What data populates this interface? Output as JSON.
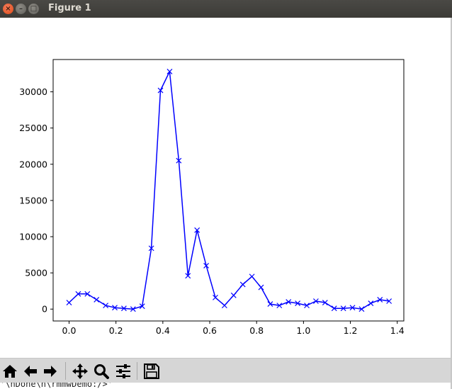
{
  "window": {
    "title": "Figure 1",
    "close_glyph": "×",
    "min_glyph": "–",
    "max_glyph": "□"
  },
  "toolbar": {
    "buttons": [
      {
        "name": "home-button",
        "icon": "home-icon"
      },
      {
        "name": "back-button",
        "icon": "arrow-left-icon"
      },
      {
        "name": "forward-button",
        "icon": "arrow-right-icon"
      },
      {
        "name": "pan-button",
        "icon": "move-icon"
      },
      {
        "name": "zoom-button",
        "icon": "magnifier-icon"
      },
      {
        "name": "subplots-button",
        "icon": "sliders-icon"
      },
      {
        "name": "save-button",
        "icon": "floppy-disk-icon"
      }
    ]
  },
  "terminal": {
    "text": "'\\nDone\\n\\rmmwDemo:/>'"
  },
  "colors": {
    "line": "#0000ff"
  },
  "chart_data": {
    "type": "line",
    "title": "",
    "xlabel": "",
    "ylabel": "",
    "marker": "x",
    "xlim": [
      -0.068,
      1.428
    ],
    "ylim": [
      -1640,
      34460
    ],
    "xticks": [
      0.0,
      0.2,
      0.4,
      0.6,
      0.8,
      1.0,
      1.2,
      1.4
    ],
    "xtick_labels": [
      "0.0",
      "0.2",
      "0.4",
      "0.6",
      "0.8",
      "1.0",
      "1.2",
      "1.4"
    ],
    "yticks": [
      0,
      5000,
      10000,
      15000,
      20000,
      25000,
      30000
    ],
    "ytick_labels": [
      "0",
      "5000",
      "10000",
      "15000",
      "20000",
      "25000",
      "30000"
    ],
    "series": [
      {
        "x": [
          0.0,
          0.039,
          0.078,
          0.117,
          0.156,
          0.195,
          0.234,
          0.273,
          0.312,
          0.351,
          0.39,
          0.429,
          0.468,
          0.507,
          0.546,
          0.585,
          0.624,
          0.663,
          0.702,
          0.741,
          0.78,
          0.819,
          0.858,
          0.897,
          0.936,
          0.975,
          1.014,
          1.053,
          1.092,
          1.131,
          1.17,
          1.209,
          1.248,
          1.287,
          1.326,
          1.365
        ],
        "y": [
          900,
          2100,
          2100,
          1300,
          500,
          200,
          100,
          0,
          400,
          8400,
          30200,
          32800,
          20500,
          4600,
          10900,
          6000,
          1600,
          500,
          1900,
          3400,
          4500,
          3000,
          700,
          500,
          1000,
          800,
          500,
          1100,
          900,
          100,
          100,
          200,
          0,
          800,
          1300,
          1100
        ]
      }
    ]
  }
}
